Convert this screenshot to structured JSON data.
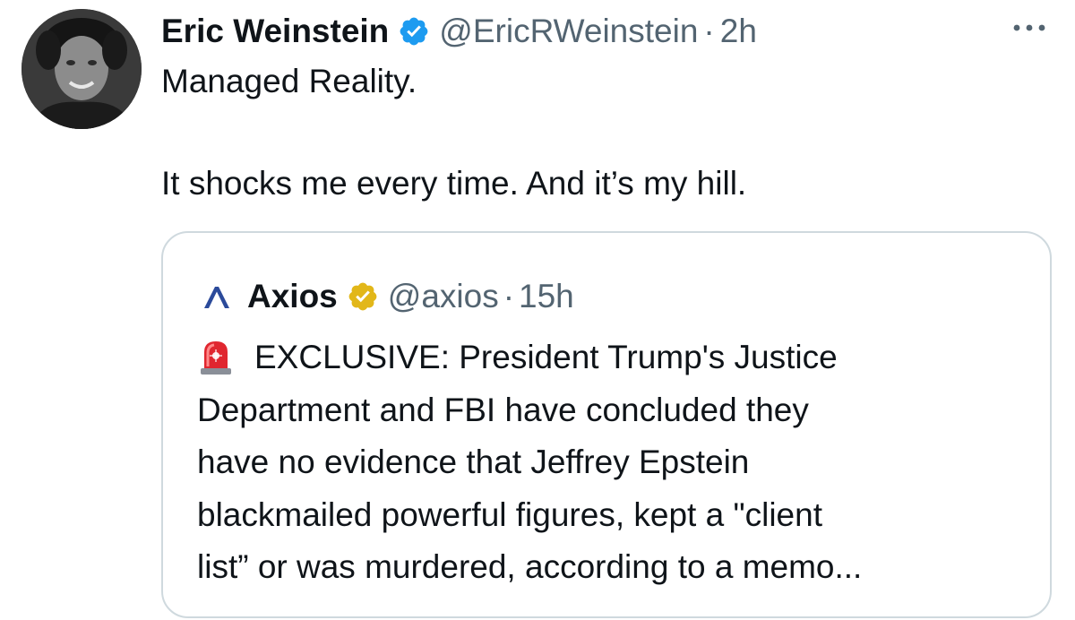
{
  "tweet": {
    "author_name": "Eric Weinstein",
    "author_handle": "@EricRWeinstein",
    "separator": "·",
    "time": "2h",
    "verified_icon": "verified-badge-blue-icon",
    "more_icon": "more-options-icon",
    "text_line_1": "Managed Reality.",
    "text_line_2": "It shocks me every time. And it’s my hill."
  },
  "quoted_tweet": {
    "logo_icon": "axios-logo-icon",
    "author_name": "Axios",
    "verified_icon": "verified-badge-gold-icon",
    "author_handle": "@axios",
    "separator": "·",
    "time": "15h",
    "siren_icon": "police-siren-emoji-icon",
    "text_lines": [
      "EXCLUSIVE: President Trump's Justice",
      "Department and FBI have concluded they",
      "have no evidence that Jeffrey Epstein",
      "blackmailed powerful figures, kept a \"client",
      "list” or was murdered, according to a memo..."
    ]
  },
  "colors": {
    "text_primary": "#0f1419",
    "text_secondary": "#536471",
    "verified_blue": "#1d9bf0",
    "verified_gold": "#e2b719",
    "border": "#cfd9de",
    "axios_logo": "#2b4a9a"
  }
}
